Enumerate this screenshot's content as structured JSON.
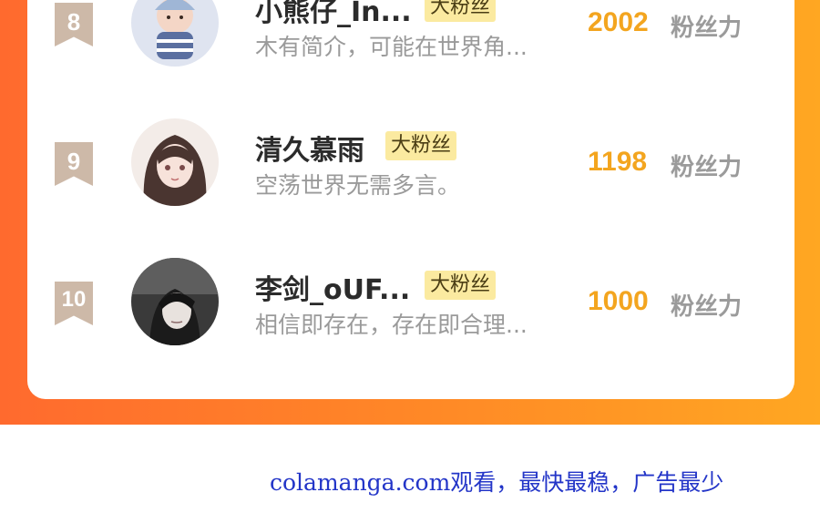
{
  "rows": [
    {
      "rank": "8",
      "name": "小熊仔_In...",
      "tag": "大粉丝",
      "bio": "木有简介，可能在世界角...",
      "score": "2002",
      "unit": "粉丝力"
    },
    {
      "rank": "9",
      "name": "清久慕雨",
      "tag": "大粉丝",
      "bio": "空荡世界无需多言。",
      "score": "1198",
      "unit": "粉丝力"
    },
    {
      "rank": "10",
      "name": "李剑_oUF...",
      "tag": "大粉丝",
      "bio": "相信即存在，存在即合理...",
      "score": "1000",
      "unit": "粉丝力"
    }
  ],
  "footer": {
    "text": "colamanga.com观看，最快最稳，广告最少"
  },
  "colors": {
    "accent": "#f3a51f",
    "tag_bg": "#fbeaa0",
    "badge": "#cdb9a8",
    "link": "#2335c8"
  }
}
